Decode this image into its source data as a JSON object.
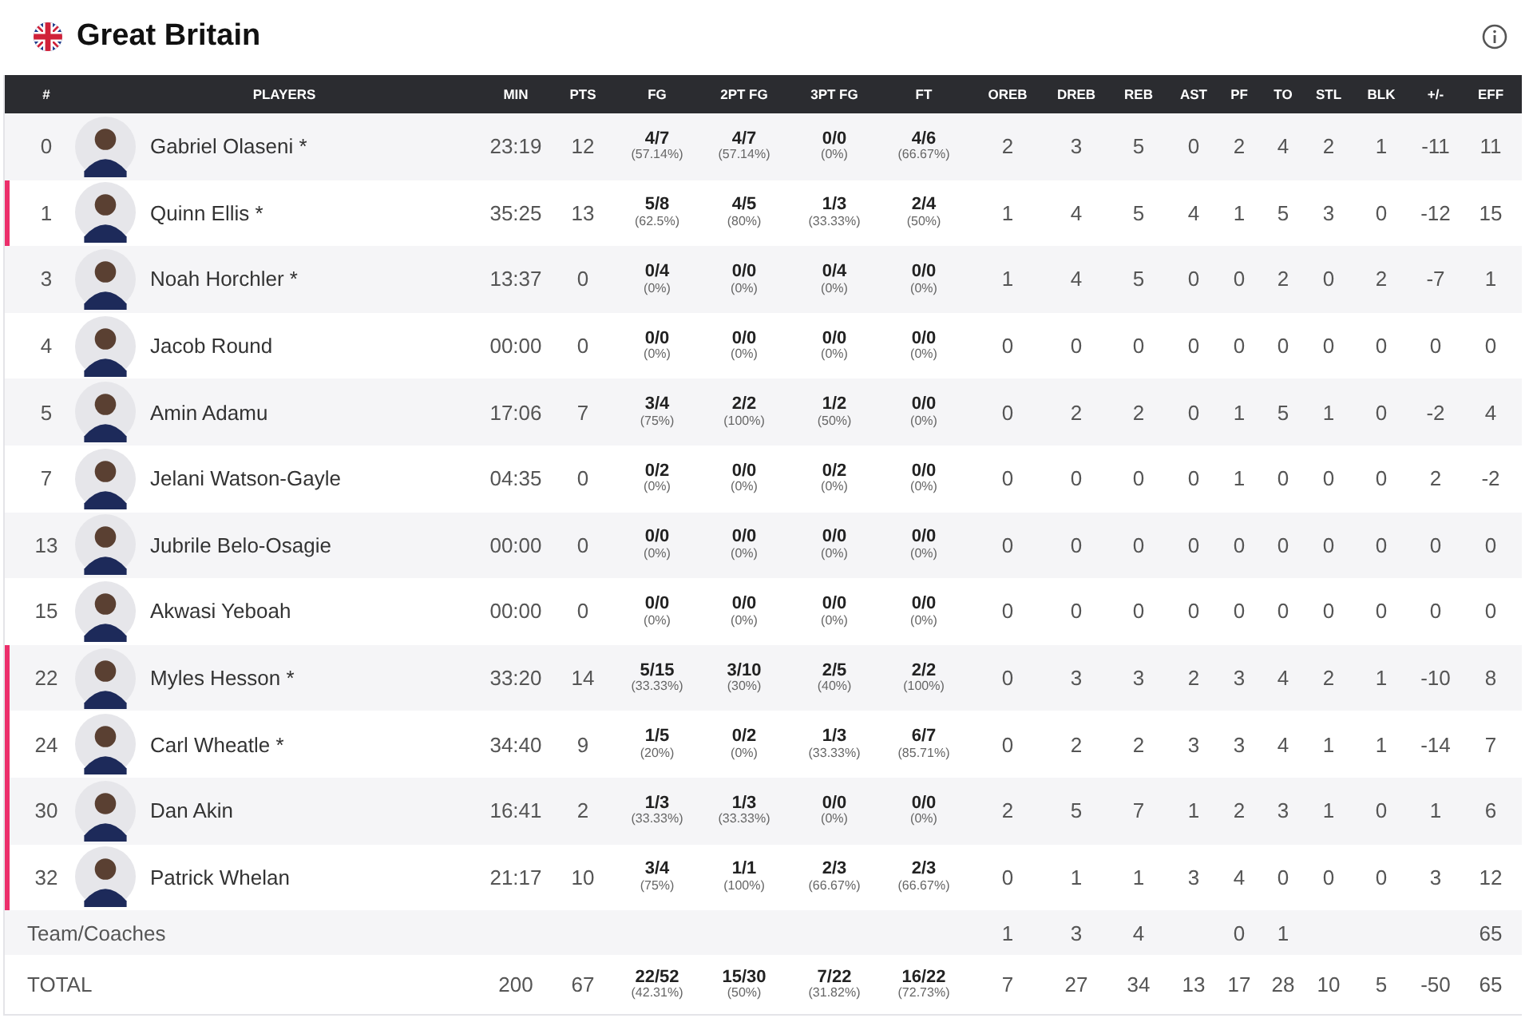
{
  "team": {
    "name": "Great Britain"
  },
  "columns": [
    "#",
    "PLAYERS",
    "MIN",
    "PTS",
    "FG",
    "2PT FG",
    "3PT FG",
    "FT",
    "OREB",
    "DREB",
    "REB",
    "AST",
    "PF",
    "TO",
    "STL",
    "BLK",
    "+/-",
    "EFF"
  ],
  "players": [
    {
      "number": "0",
      "name": "Gabriel Olaseni *",
      "on_court": false,
      "min": "23:19",
      "pts": "12",
      "shooting": [
        {
          "made": "4/7",
          "pct": "(57.14%)"
        },
        {
          "made": "4/7",
          "pct": "(57.14%)"
        },
        {
          "made": "0/0",
          "pct": "(0%)"
        },
        {
          "made": "4/6",
          "pct": "(66.67%)"
        }
      ],
      "stats": [
        "2",
        "3",
        "5",
        "0",
        "2",
        "4",
        "2",
        "1",
        "-11",
        "11"
      ]
    },
    {
      "number": "1",
      "name": "Quinn Ellis *",
      "on_court": true,
      "min": "35:25",
      "pts": "13",
      "shooting": [
        {
          "made": "5/8",
          "pct": "(62.5%)"
        },
        {
          "made": "4/5",
          "pct": "(80%)"
        },
        {
          "made": "1/3",
          "pct": "(33.33%)"
        },
        {
          "made": "2/4",
          "pct": "(50%)"
        }
      ],
      "stats": [
        "1",
        "4",
        "5",
        "4",
        "1",
        "5",
        "3",
        "0",
        "-12",
        "15"
      ]
    },
    {
      "number": "3",
      "name": "Noah Horchler *",
      "on_court": false,
      "min": "13:37",
      "pts": "0",
      "shooting": [
        {
          "made": "0/4",
          "pct": "(0%)"
        },
        {
          "made": "0/0",
          "pct": "(0%)"
        },
        {
          "made": "0/4",
          "pct": "(0%)"
        },
        {
          "made": "0/0",
          "pct": "(0%)"
        }
      ],
      "stats": [
        "1",
        "4",
        "5",
        "0",
        "0",
        "2",
        "0",
        "2",
        "-7",
        "1"
      ]
    },
    {
      "number": "4",
      "name": "Jacob Round",
      "on_court": false,
      "min": "00:00",
      "pts": "0",
      "shooting": [
        {
          "made": "0/0",
          "pct": "(0%)"
        },
        {
          "made": "0/0",
          "pct": "(0%)"
        },
        {
          "made": "0/0",
          "pct": "(0%)"
        },
        {
          "made": "0/0",
          "pct": "(0%)"
        }
      ],
      "stats": [
        "0",
        "0",
        "0",
        "0",
        "0",
        "0",
        "0",
        "0",
        "0",
        "0"
      ]
    },
    {
      "number": "5",
      "name": "Amin Adamu",
      "on_court": false,
      "min": "17:06",
      "pts": "7",
      "shooting": [
        {
          "made": "3/4",
          "pct": "(75%)"
        },
        {
          "made": "2/2",
          "pct": "(100%)"
        },
        {
          "made": "1/2",
          "pct": "(50%)"
        },
        {
          "made": "0/0",
          "pct": "(0%)"
        }
      ],
      "stats": [
        "0",
        "2",
        "2",
        "0",
        "1",
        "5",
        "1",
        "0",
        "-2",
        "4"
      ]
    },
    {
      "number": "7",
      "name": "Jelani Watson-Gayle",
      "on_court": false,
      "min": "04:35",
      "pts": "0",
      "shooting": [
        {
          "made": "0/2",
          "pct": "(0%)"
        },
        {
          "made": "0/0",
          "pct": "(0%)"
        },
        {
          "made": "0/2",
          "pct": "(0%)"
        },
        {
          "made": "0/0",
          "pct": "(0%)"
        }
      ],
      "stats": [
        "0",
        "0",
        "0",
        "0",
        "1",
        "0",
        "0",
        "0",
        "2",
        "-2"
      ]
    },
    {
      "number": "13",
      "name": "Jubrile Belo-Osagie",
      "on_court": false,
      "min": "00:00",
      "pts": "0",
      "shooting": [
        {
          "made": "0/0",
          "pct": "(0%)"
        },
        {
          "made": "0/0",
          "pct": "(0%)"
        },
        {
          "made": "0/0",
          "pct": "(0%)"
        },
        {
          "made": "0/0",
          "pct": "(0%)"
        }
      ],
      "stats": [
        "0",
        "0",
        "0",
        "0",
        "0",
        "0",
        "0",
        "0",
        "0",
        "0"
      ]
    },
    {
      "number": "15",
      "name": "Akwasi Yeboah",
      "on_court": false,
      "min": "00:00",
      "pts": "0",
      "shooting": [
        {
          "made": "0/0",
          "pct": "(0%)"
        },
        {
          "made": "0/0",
          "pct": "(0%)"
        },
        {
          "made": "0/0",
          "pct": "(0%)"
        },
        {
          "made": "0/0",
          "pct": "(0%)"
        }
      ],
      "stats": [
        "0",
        "0",
        "0",
        "0",
        "0",
        "0",
        "0",
        "0",
        "0",
        "0"
      ]
    },
    {
      "number": "22",
      "name": "Myles Hesson *",
      "on_court": true,
      "min": "33:20",
      "pts": "14",
      "shooting": [
        {
          "made": "5/15",
          "pct": "(33.33%)"
        },
        {
          "made": "3/10",
          "pct": "(30%)"
        },
        {
          "made": "2/5",
          "pct": "(40%)"
        },
        {
          "made": "2/2",
          "pct": "(100%)"
        }
      ],
      "stats": [
        "0",
        "3",
        "3",
        "2",
        "3",
        "4",
        "2",
        "1",
        "-10",
        "8"
      ]
    },
    {
      "number": "24",
      "name": "Carl Wheatle *",
      "on_court": true,
      "min": "34:40",
      "pts": "9",
      "shooting": [
        {
          "made": "1/5",
          "pct": "(20%)"
        },
        {
          "made": "0/2",
          "pct": "(0%)"
        },
        {
          "made": "1/3",
          "pct": "(33.33%)"
        },
        {
          "made": "6/7",
          "pct": "(85.71%)"
        }
      ],
      "stats": [
        "0",
        "2",
        "2",
        "3",
        "3",
        "4",
        "1",
        "1",
        "-14",
        "7"
      ]
    },
    {
      "number": "30",
      "name": "Dan Akin",
      "on_court": true,
      "min": "16:41",
      "pts": "2",
      "shooting": [
        {
          "made": "1/3",
          "pct": "(33.33%)"
        },
        {
          "made": "1/3",
          "pct": "(33.33%)"
        },
        {
          "made": "0/0",
          "pct": "(0%)"
        },
        {
          "made": "0/0",
          "pct": "(0%)"
        }
      ],
      "stats": [
        "2",
        "5",
        "7",
        "1",
        "2",
        "3",
        "1",
        "0",
        "1",
        "6"
      ]
    },
    {
      "number": "32",
      "name": "Patrick Whelan",
      "on_court": true,
      "min": "21:17",
      "pts": "10",
      "shooting": [
        {
          "made": "3/4",
          "pct": "(75%)"
        },
        {
          "made": "1/1",
          "pct": "(100%)"
        },
        {
          "made": "2/3",
          "pct": "(66.67%)"
        },
        {
          "made": "2/3",
          "pct": "(66.67%)"
        }
      ],
      "stats": [
        "0",
        "1",
        "1",
        "3",
        "4",
        "0",
        "0",
        "0",
        "3",
        "12"
      ]
    }
  ],
  "team_row": {
    "label": "Team/Coaches",
    "stats": {
      "oreb": "1",
      "dreb": "3",
      "reb": "4",
      "pf": "0",
      "to": "1",
      "eff": "65"
    }
  },
  "total_row": {
    "label": "TOTAL",
    "min": "200",
    "pts": "67",
    "shooting": [
      {
        "made": "22/52",
        "pct": "(42.31%)"
      },
      {
        "made": "15/30",
        "pct": "(50%)"
      },
      {
        "made": "7/22",
        "pct": "(31.82%)"
      },
      {
        "made": "16/22",
        "pct": "(72.73%)"
      }
    ],
    "stats": [
      "7",
      "27",
      "34",
      "13",
      "17",
      "28",
      "10",
      "5",
      "-50",
      "65"
    ]
  }
}
